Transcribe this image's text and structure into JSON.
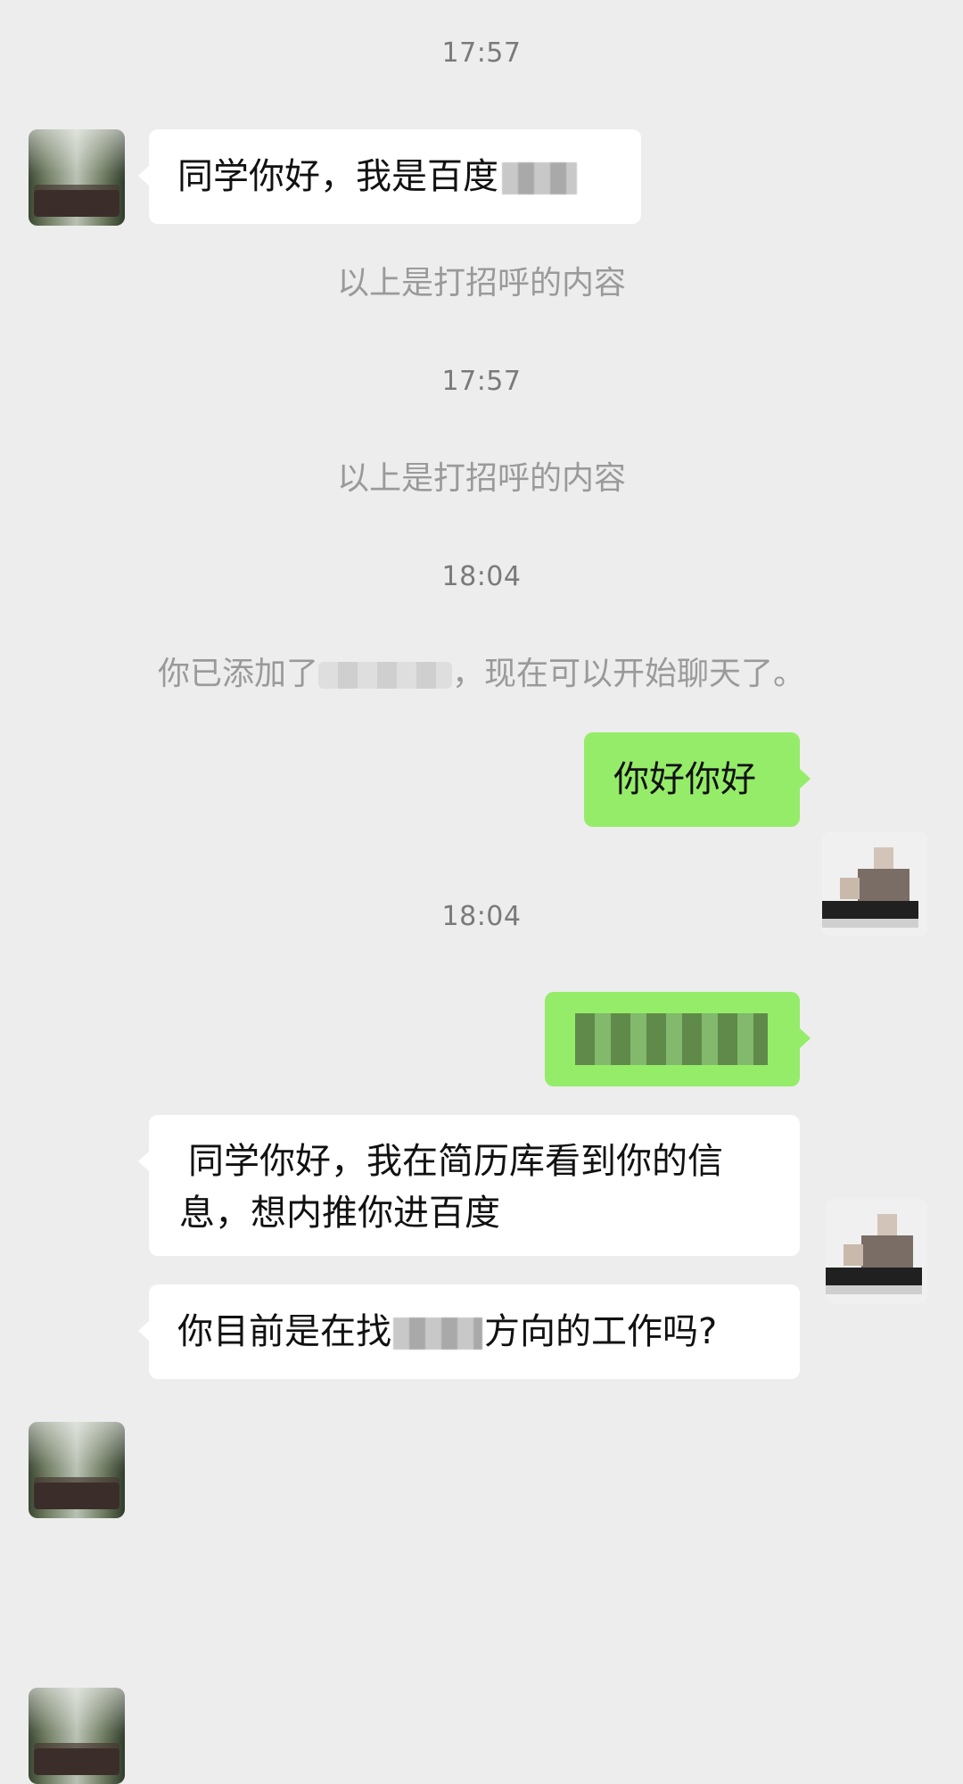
{
  "chat": {
    "timestamps": [
      "17:57",
      "17:57",
      "18:04",
      "18:04"
    ],
    "system_notes": {
      "greeting_note_1": "以上是打招呼的内容",
      "greeting_note_2": "以上是打招呼的内容",
      "added_prefix": "你已添加了",
      "added_suffix": "，现在可以开始聊天了。"
    },
    "messages": [
      {
        "side": "left",
        "text": "同学你好，我是百度"
      },
      {
        "side": "right",
        "text": "你好你好"
      },
      {
        "side": "right",
        "text": ""
      },
      {
        "side": "left",
        "text_line1": "同学你好，我在简历库看到你的信",
        "text_line2": "息，想内推你进百度"
      },
      {
        "side": "left",
        "text_prefix": "你目前是在找",
        "text_suffix": "方向的工作吗?"
      }
    ]
  }
}
